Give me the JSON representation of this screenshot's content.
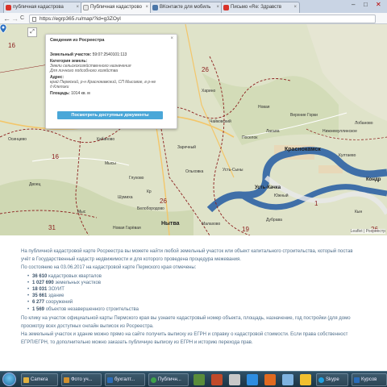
{
  "browser": {
    "tabs": [
      {
        "label": "публичная кадастрова",
        "icon_color": "#d9332a"
      },
      {
        "label": "Публичная кадастрово",
        "icon_color": "#e8e8e8"
      },
      {
        "label": "ВКонтакте для мобиль",
        "icon_color": "#4a76a8"
      },
      {
        "label": "Письмо «Re: Здравств",
        "icon_color": "#d9332a"
      }
    ],
    "url": "https://egrp365.ru/map/?id=g3ZOyI",
    "window_controls": {
      "minimize": "–",
      "maximize": "□",
      "close": "✕"
    },
    "nav": {
      "back": "←",
      "forward": "→",
      "reload": "C"
    }
  },
  "map": {
    "expand_icon": "⤢",
    "popup": {
      "title": "Сведения из Росреестра",
      "parcel_label": "Земельный участок:",
      "parcel_value": "59:07:2540101:113",
      "category_label": "Категория земель:",
      "category_value": "Земли сельскохозяйственного назначения",
      "use_value": "Для личного подсобного хозяйства",
      "address_label": "Адрес:",
      "address_value_1": "край Пермский, р-н Краснокамский, СП Мысовое, в р-не",
      "address_value_2": "д Клепики",
      "area_label": "Площадь:",
      "area_value": "1014 кв. м",
      "button_label": "Посмотреть доступные документы",
      "close_icon": "×"
    },
    "district_numbers": [
      {
        "text": "16",
        "pos": "a"
      },
      {
        "text": "26",
        "pos": "b"
      },
      {
        "text": "16",
        "pos": "c"
      },
      {
        "text": "26",
        "pos": "d"
      },
      {
        "text": "31",
        "pos": "e"
      },
      {
        "text": "1",
        "pos": "f"
      },
      {
        "text": "19",
        "pos": "g"
      },
      {
        "text": "26",
        "pos": "h"
      }
    ],
    "cities": {
      "krasnokamsk": "Краснокамск",
      "ust_kachka": "Усть-Качка",
      "nytva": "Нытва",
      "kondratovo": "Кондр"
    },
    "place_labels": {
      "l1": "Чайковский",
      "l2": "Новая",
      "l3": "Поселок",
      "l4": "Ласьва",
      "l5": "Усть-Сыны",
      "l6": "Глухово",
      "l7": "Мысы",
      "l8": "Шумиха",
      "l9": "Кр",
      "l10": "Белобородово",
      "l11": "Новая Гарёвая",
      "l12": "Осинцево",
      "l13": "Двоец",
      "l14": "Кабаново",
      "l15": "Заречный",
      "l16": "Ольховка",
      "l17": "Мыс",
      "l18": "Малахово",
      "l19": "Верхние Горки",
      "l20": "Нижнемуллинское",
      "l21": "Култаево",
      "l22": "Дубрава",
      "l23": "Южный",
      "l24": "Кын",
      "l25": "Лобаново",
      "l26": "Харино"
    },
    "attribution": "Leaflet | Росреестр"
  },
  "content": {
    "intro": "На публичной кадастровой карте Росреестра вы можете найти любой земельный участок или объект капитального строительства, который постав",
    "intro2": "учёт в Государственный кадастр недвижимости и для которого проведена процедура межевания.",
    "state_line": "По состоянию на 03.06.2017 на кадастровой карте Пермского края отмечены:",
    "stats": [
      {
        "value": "36 610",
        "label": "кадастровых кварталов"
      },
      {
        "value": "1 027 690",
        "label": "земельных участков"
      },
      {
        "value": "18 031",
        "label": "ЗОУИТ"
      },
      {
        "value": "35 661",
        "label": "здание"
      },
      {
        "value": "6 277",
        "label": "сооружений"
      },
      {
        "value": "1 569",
        "label": "объектов незавершенного строительства"
      }
    ],
    "para2a": "По клику на участок официальной карты Пермского края вы узнаете кадастровый номер объекта, площадь, назначение, год постройки (для домо",
    "para2b": "просмотру всех доступных онлайн выписок из Росреестра.",
    "para3a": "На земельный участок и здание можно прямо на сайте получить выписку из ЕГРН и справку о кадастровой стоимости. Если права собственност",
    "para3b": "ЕГРП/ЕГРН, то дополнительно можно заказать публичную выписку из ЕГРН и историю перехода прав."
  },
  "taskbar": {
    "items": [
      {
        "label": "Camera",
        "color": "#e0b040"
      },
      {
        "label": "Фото уч...",
        "color": "#d09030"
      },
      {
        "label": "бухгалт...",
        "color": "#2b6cb8"
      },
      {
        "label": "Публичн...",
        "color": "#3fa14a"
      },
      {
        "label": "Skype",
        "color": "#1fa0e0"
      },
      {
        "label": "Курсов",
        "color": "#2b6cb8"
      }
    ]
  },
  "colors": {
    "accent": "#4aa7d8",
    "link_text": "#4f6e8a",
    "district_border": "#8b1d1d",
    "river": "#3f6fa8"
  }
}
